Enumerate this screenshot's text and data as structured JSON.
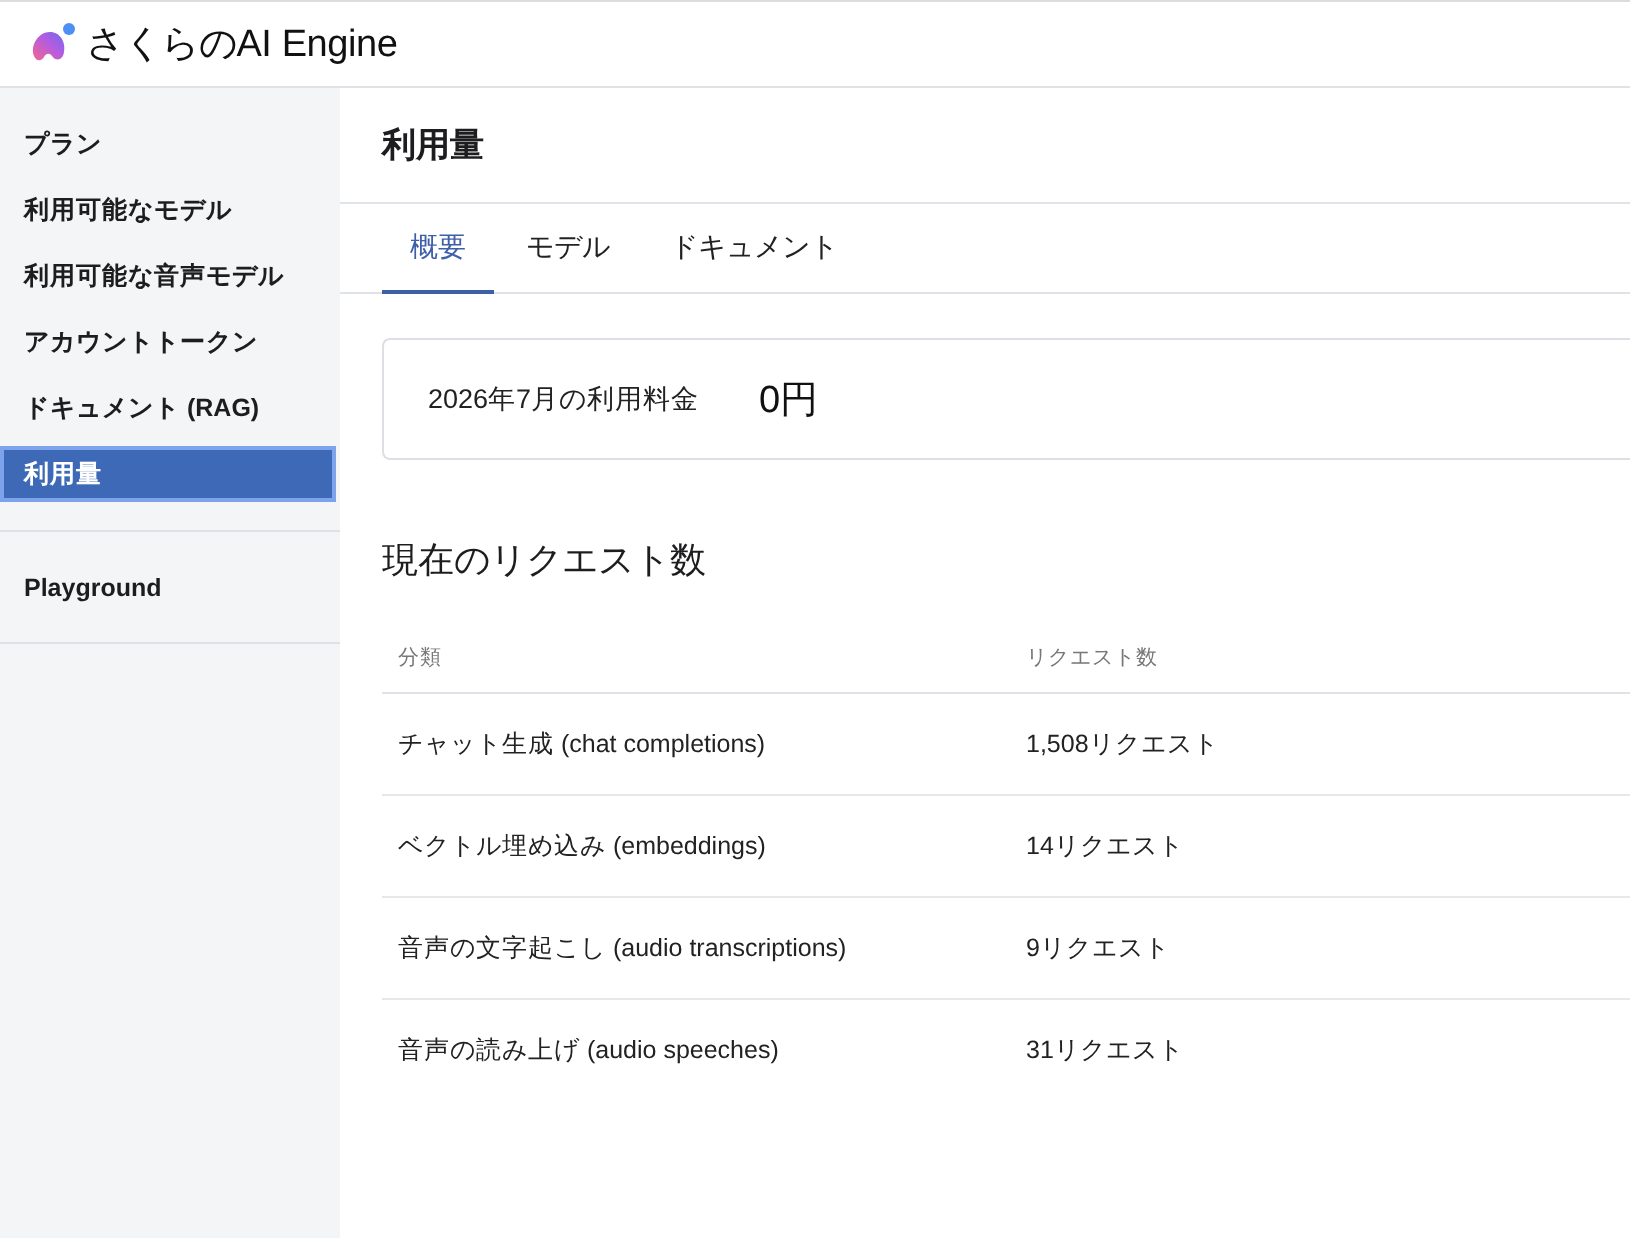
{
  "header": {
    "logo_text": "さくらのAI Engine"
  },
  "sidebar": {
    "groups": [
      {
        "items": [
          {
            "label": "プラン",
            "selected": false
          },
          {
            "label": "利用可能なモデル",
            "selected": false
          },
          {
            "label": "利用可能な音声モデル",
            "selected": false
          },
          {
            "label": "アカウントトークン",
            "selected": false
          },
          {
            "label": "ドキュメント (RAG)",
            "selected": false
          },
          {
            "label": "利用量",
            "selected": true
          }
        ]
      },
      {
        "items": [
          {
            "label": "Playground",
            "selected": false
          }
        ]
      }
    ]
  },
  "page": {
    "title": "利用量"
  },
  "tabs": [
    {
      "label": "概要",
      "selected": true
    },
    {
      "label": "モデル",
      "selected": false
    },
    {
      "label": "ドキュメント",
      "selected": false
    }
  ],
  "billing": {
    "label": "2026年7月の利用料金",
    "amount": "0円"
  },
  "requests": {
    "heading": "現在のリクエスト数",
    "columns": [
      "分類",
      "リクエスト数"
    ],
    "rows": [
      [
        "チャット生成 (chat completions)",
        "1,508リクエスト"
      ],
      [
        "ベクトル埋め込み (embeddings)",
        "14リクエスト"
      ],
      [
        "音声の文字起こし (audio transcriptions)",
        "9リクエスト"
      ],
      [
        "音声の読み上げ (audio speeches)",
        "31リクエスト"
      ]
    ]
  }
}
